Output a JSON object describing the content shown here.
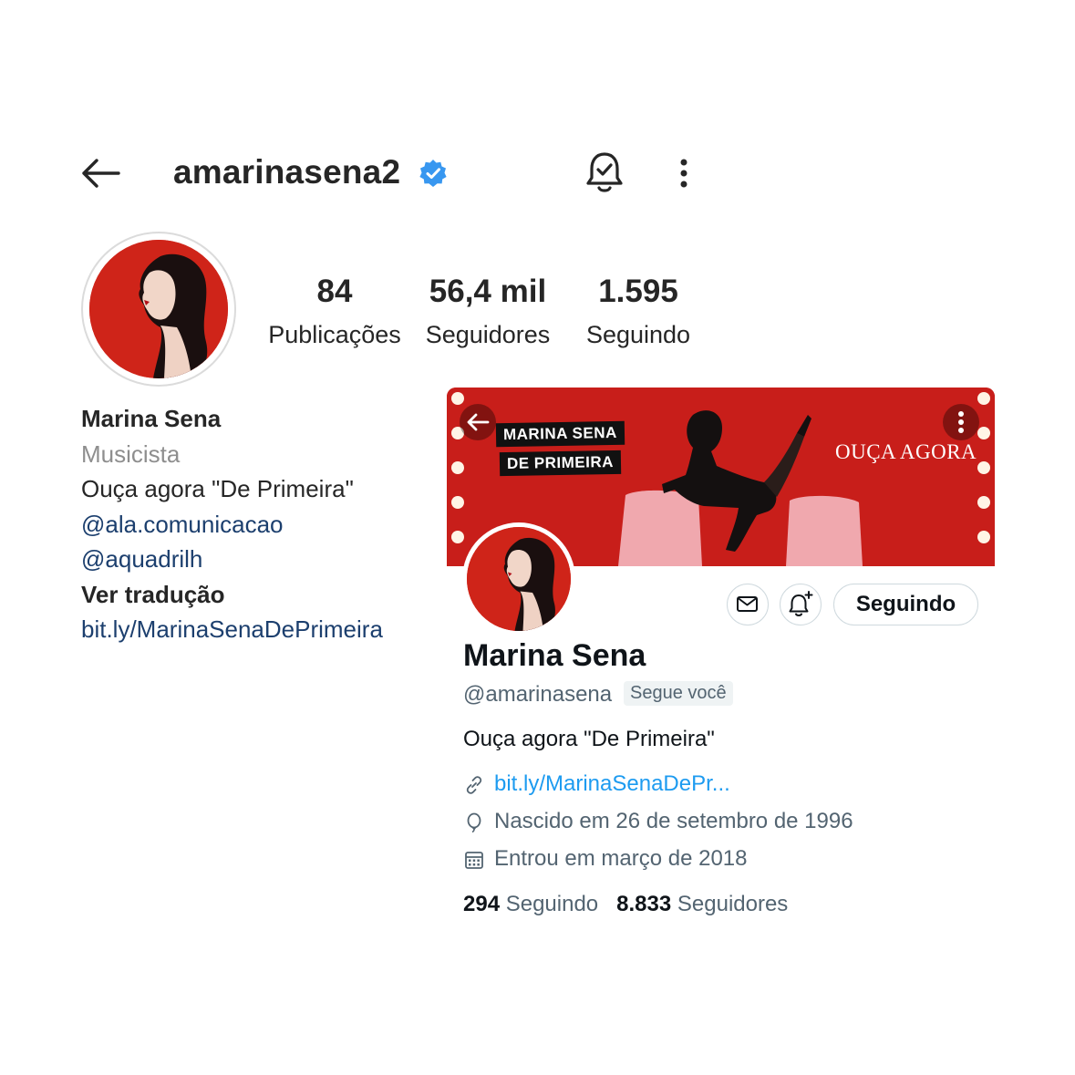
{
  "instagram": {
    "username": "amarinasena2",
    "verified": true,
    "stats": [
      {
        "value": "84",
        "label": "Publicações"
      },
      {
        "value": "56,4 mil",
        "label": "Seguidores"
      },
      {
        "value": "1.595",
        "label": "Seguindo"
      }
    ],
    "bio": {
      "name": "Marina Sena",
      "category": "Musicista",
      "text": "Ouça agora \"De Primeira\"",
      "mentions": [
        "@ala.comunicacao",
        "@aquadrilh"
      ],
      "translate": "Ver tradução",
      "link": "bit.ly/MarinaSenaDePrimeira"
    },
    "icons": {
      "back": "back-arrow-icon",
      "verified": "verified-badge-icon",
      "notifications": "bell-check-icon",
      "more": "more-vertical-icon"
    },
    "colors": {
      "verified": "#3897f0",
      "link": "#1c3f6e",
      "secondary": "#8e8e8e"
    }
  },
  "twitter": {
    "banner": {
      "tag_line_1": "MARINA SENA",
      "tag_line_2": "DE PRIMEIRA",
      "cta": "OUÇA AGORA",
      "color": "#c81e1a"
    },
    "follow_button": "Seguindo",
    "name": "Marina Sena",
    "handle": "@amarinasena",
    "follows_you": "Segue você",
    "bio": "Ouça agora \"De Primeira\"",
    "link": "bit.ly/MarinaSenaDePr...",
    "birth": "Nascido em 26 de setembro de 1996",
    "joined": "Entrou em março de 2018",
    "following_count": "294",
    "following_label": "Seguindo",
    "followers_count": "8.833",
    "followers_label": "Seguidores",
    "colors": {
      "link": "#1d9bf0",
      "secondary": "#536471",
      "primary": "#0f1419"
    }
  }
}
